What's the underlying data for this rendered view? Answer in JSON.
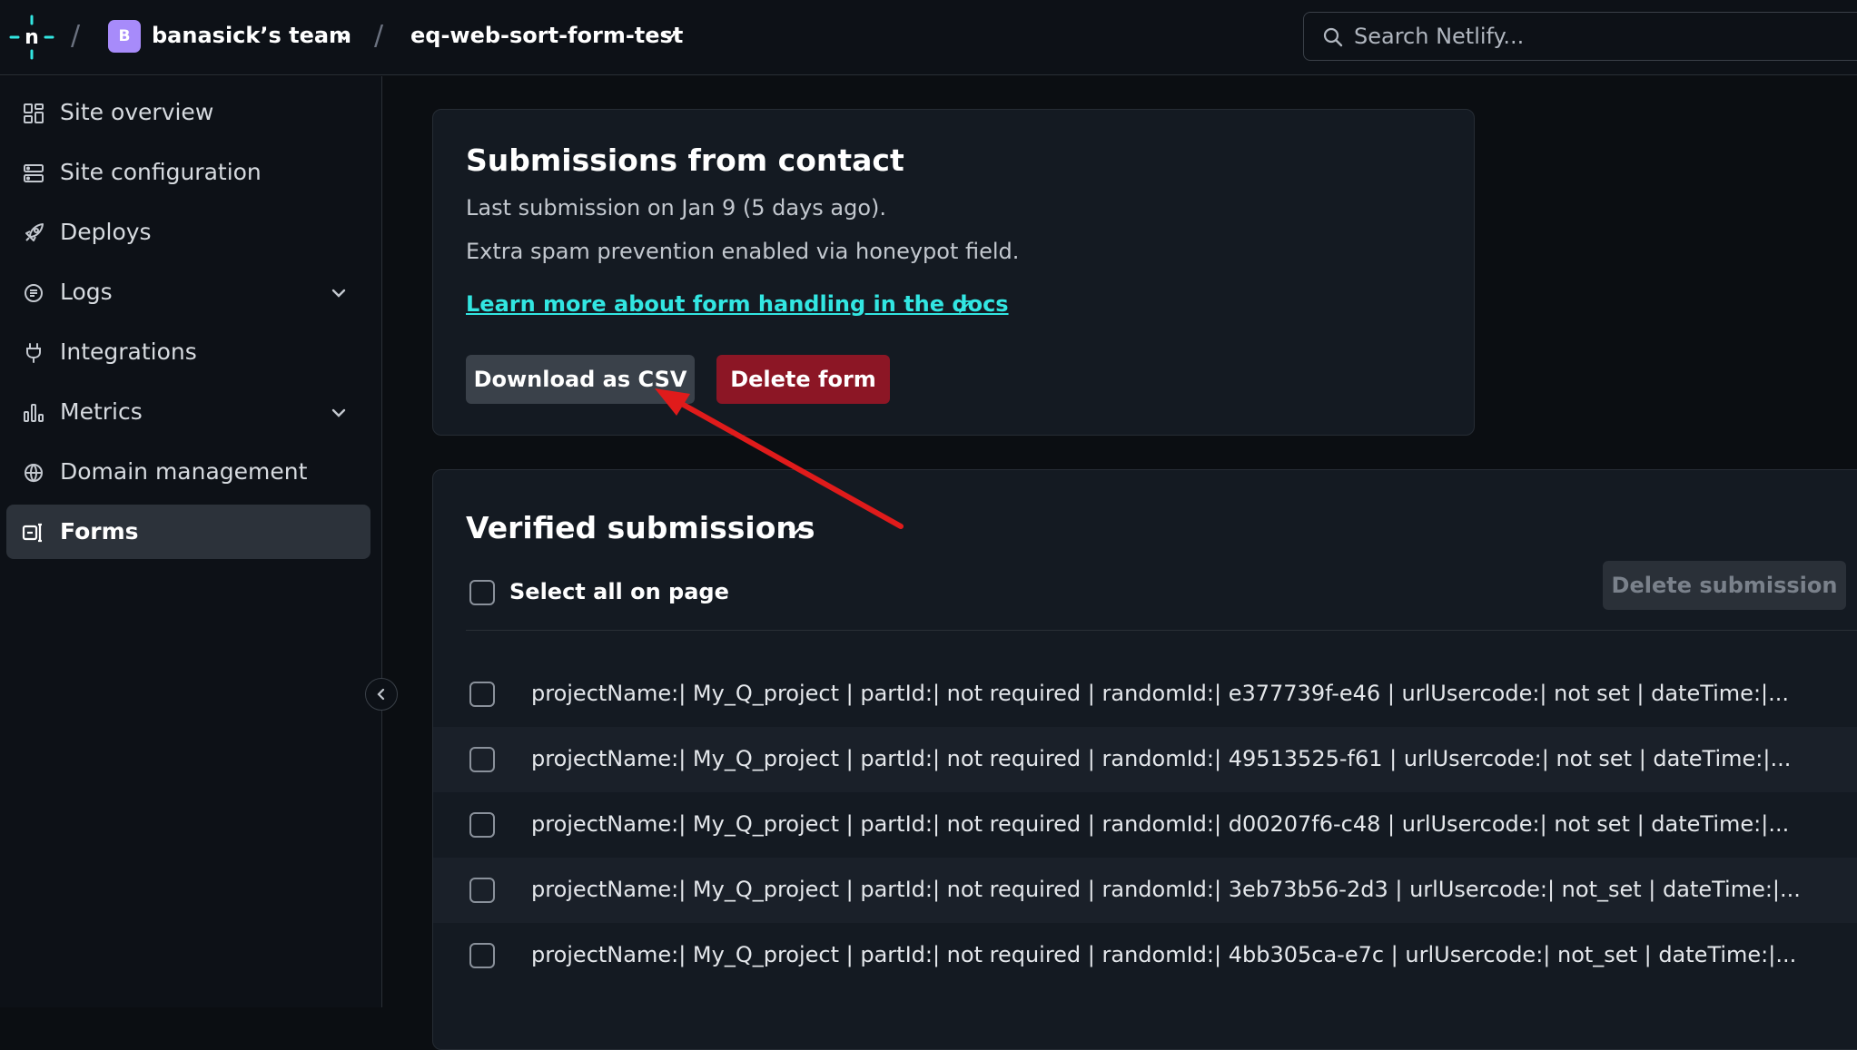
{
  "topbar": {
    "team_initial": "B",
    "team_name": "banasick’s team",
    "site_name": "eq-web-sort-form-test",
    "search_placeholder": "Search Netlify..."
  },
  "sidebar": {
    "items": [
      {
        "label": "Site overview",
        "icon": "grid-icon"
      },
      {
        "label": "Site configuration",
        "icon": "server-icon"
      },
      {
        "label": "Deploys",
        "icon": "rocket-icon"
      },
      {
        "label": "Logs",
        "icon": "logs-icon",
        "expandable": true
      },
      {
        "label": "Integrations",
        "icon": "plug-icon"
      },
      {
        "label": "Metrics",
        "icon": "bar-chart-icon",
        "expandable": true
      },
      {
        "label": "Domain management",
        "icon": "globe-icon"
      },
      {
        "label": "Forms",
        "icon": "forms-icon",
        "active": true
      }
    ]
  },
  "form_card": {
    "title": "Submissions from contact",
    "last_submission": "Last submission on Jan 9 (5 days ago).",
    "spam_note": "Extra spam prevention enabled via honeypot field.",
    "docs_link": "Learn more about form handling in the docs",
    "download_label": "Download as CSV",
    "delete_label": "Delete form"
  },
  "submissions": {
    "title": "Verified submissions",
    "select_all_label": "Select all on page",
    "delete_submission_label": "Delete submission",
    "rows": [
      "projectName:| My_Q_project | partId:| not required | randomId:| e377739f-e46 | urlUsercode:| not set | dateTime:|...",
      "projectName:| My_Q_project | partId:| not required | randomId:| 49513525-f61 | urlUsercode:| not set | dateTime:|...",
      "projectName:| My_Q_project | partId:| not required | randomId:| d00207f6-c48 | urlUsercode:| not set | dateTime:|...",
      "projectName:| My_Q_project | partId:| not required | randomId:| 3eb73b56-2d3 | urlUsercode:| not_set | dateTime:|...",
      "projectName:| My_Q_project | partId:| not required | randomId:| 4bb305ca-e7c | urlUsercode:| not_set | dateTime:|..."
    ]
  },
  "colors": {
    "accent_link": "#32e6e2",
    "danger": "#8c1625",
    "annotation_arrow": "#e01b1b"
  }
}
